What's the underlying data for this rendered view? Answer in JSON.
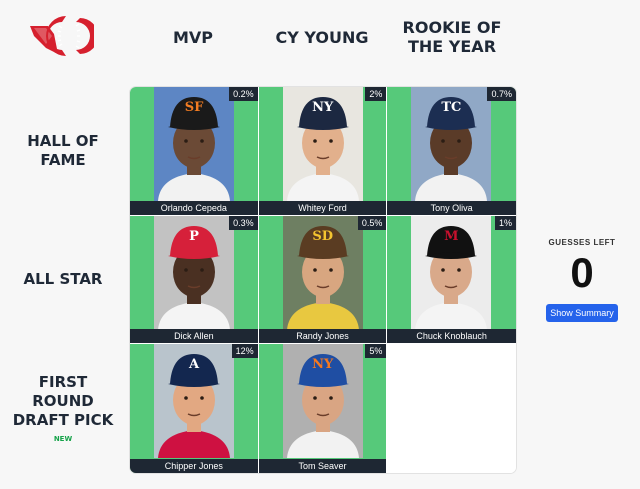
{
  "columns": [
    "MVP",
    "CY YOUNG",
    "ROOKIE OF THE YEAR"
  ],
  "rows": [
    {
      "label": "HALL OF FAME",
      "sub": ""
    },
    {
      "label": "ALL STAR",
      "sub": ""
    },
    {
      "label": "FIRST ROUND DRAFT PICK",
      "sub": "NEW"
    }
  ],
  "cells": [
    {
      "name": "Orlando Cepeda",
      "pct": "0.2%",
      "cap_letters": "SF",
      "cap_color": "#1a1a1a",
      "logo_color": "#f27c22",
      "bg": "#5d86c4",
      "skin": "#6b4a36",
      "jersey": "#f2f2f2"
    },
    {
      "name": "Whitey Ford",
      "pct": "2%",
      "cap_letters": "NY",
      "cap_color": "#1c2841",
      "logo_color": "#ffffff",
      "bg": "#e8e6e0",
      "skin": "#e2b08c",
      "jersey": "#f4f4f4"
    },
    {
      "name": "Tony Oliva",
      "pct": "0.7%",
      "cap_letters": "TC",
      "cap_color": "#1c2e52",
      "logo_color": "#ffffff",
      "bg": "#90a8c6",
      "skin": "#5a3b28",
      "jersey": "#f2f2f2"
    },
    {
      "name": "Dick Allen",
      "pct": "0.3%",
      "cap_letters": "P",
      "cap_color": "#d6203a",
      "logo_color": "#ffffff",
      "bg": "#c2c2c2",
      "skin": "#4a3022",
      "jersey": "#f4f4f4"
    },
    {
      "name": "Randy Jones",
      "pct": "0.5%",
      "cap_letters": "SD",
      "cap_color": "#5a3c22",
      "logo_color": "#f4c430",
      "bg": "#6e7f62",
      "skin": "#d8a680",
      "jersey": "#e8c840"
    },
    {
      "name": "Chuck Knoblauch",
      "pct": "1%",
      "cap_letters": "M",
      "cap_color": "#111111",
      "logo_color": "#c8102e",
      "bg": "#ececec",
      "skin": "#d9a98a",
      "jersey": "#f4f4f4"
    },
    {
      "name": "Chipper Jones",
      "pct": "12%",
      "cap_letters": "A",
      "cap_color": "#13274f",
      "logo_color": "#ffffff",
      "bg": "#b9c4cc",
      "skin": "#e2a882",
      "jersey": "#ce1141"
    },
    {
      "name": "Tom Seaver",
      "pct": "5%",
      "cap_letters": "NY",
      "cap_color": "#1f4ea3",
      "logo_color": "#f47920",
      "bg": "#b0b0b0",
      "skin": "#d9a583",
      "jersey": "#f2f2f2"
    },
    null
  ],
  "guesses": {
    "label": "GUESSES LEFT",
    "count": "0"
  },
  "summary_button": "Show Summary",
  "colors": {
    "correct": "#56c97a",
    "caption": "#1e2733",
    "button": "#2563eb",
    "logo": "#d6202e"
  }
}
